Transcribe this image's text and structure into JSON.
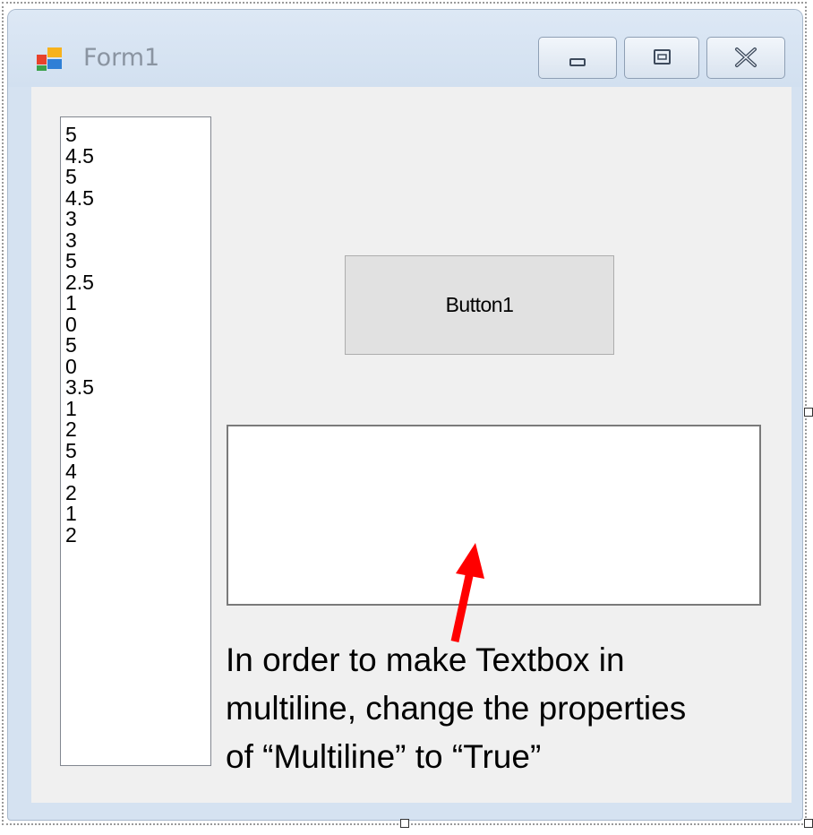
{
  "window": {
    "title": "Form1",
    "controls": {
      "minimize_icon": "minimize-icon",
      "maximize_icon": "maximize-icon",
      "close_icon": "close-icon"
    }
  },
  "listbox": {
    "items": [
      "5",
      "4.5",
      "5",
      "4.5",
      "3",
      "3",
      "5",
      "2.5",
      "1",
      "0",
      "5",
      "0",
      "3.5",
      "1",
      "2",
      "5",
      "4",
      "2",
      "1",
      "2"
    ]
  },
  "button1": {
    "label": "Button1"
  },
  "textbox": {
    "value": ""
  },
  "annotation": {
    "line1": "In order to make Textbox in",
    "line2": "multiline, change the properties",
    "line3": "of “Multiline” to “True”",
    "arrow_color": "#ff0000"
  },
  "colors": {
    "frame": "#d5e2f1",
    "client": "#f0f0f0",
    "button": "#e1e1e1"
  }
}
